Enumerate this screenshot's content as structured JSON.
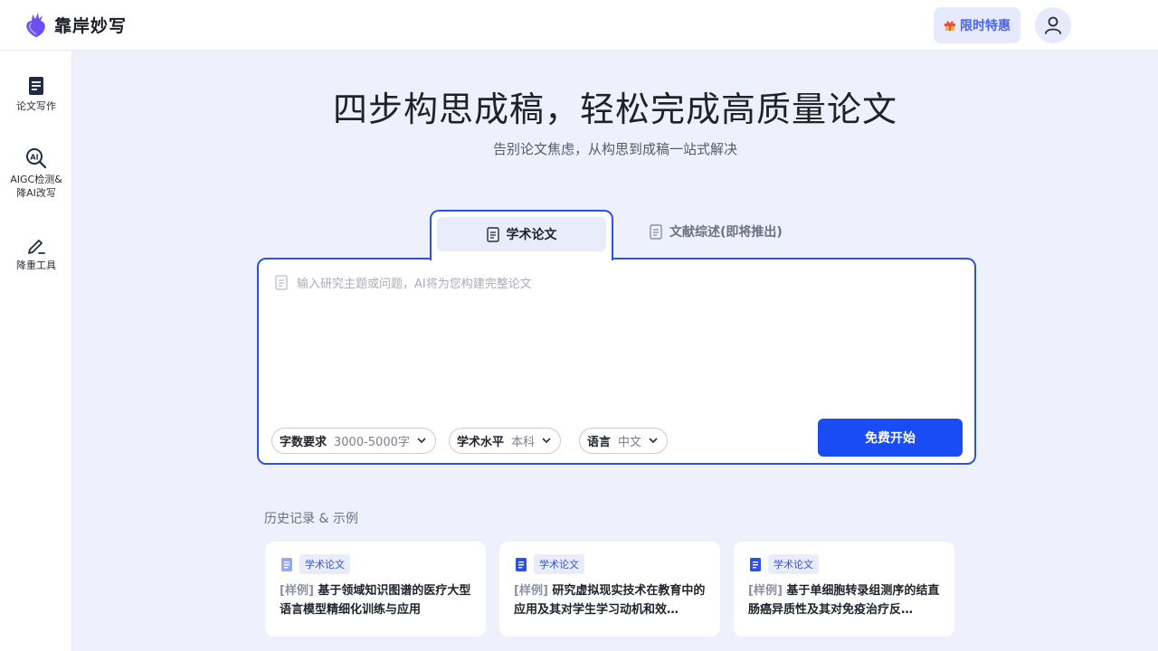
{
  "header": {
    "brand": "靠岸妙写",
    "promo_label": "限时特惠",
    "promo_icon": "gift-icon",
    "avatar_icon": "user-icon"
  },
  "sidebar": {
    "items": [
      {
        "label": "论文写作",
        "icon": "document-icon"
      },
      {
        "label": "AIGC检测&",
        "label2": "降AI改写",
        "icon": "ai-search-icon"
      },
      {
        "label": "降重工具",
        "icon": "pen-icon"
      }
    ]
  },
  "hero": {
    "title": "四步构思成稿，轻松完成高质量论文",
    "subtitle": "告别论文焦虑，从构思到成稿一站式解决"
  },
  "tabs": [
    {
      "label": "学术论文",
      "active": true
    },
    {
      "label": "文献综述(即将推出)",
      "active": false
    }
  ],
  "editor": {
    "placeholder": "输入研究主题或问题，AI将为您构建完整论文"
  },
  "options": {
    "word_count": {
      "key": "字数要求",
      "value": "3000-5000字"
    },
    "level": {
      "key": "学术水平",
      "value": "本科"
    },
    "language": {
      "key": "语言",
      "value": "中文"
    }
  },
  "start_button": "免费开始",
  "history": {
    "title": "历史记录 & 示例",
    "cards": [
      {
        "tag": "学术论文",
        "prefix": "[样例]",
        "text": "基于领域知识图谱的医疗大型语言模型精细化训练与应用"
      },
      {
        "tag": "学术论文",
        "prefix": "[样例]",
        "text": "研究虚拟现实技术在教育中的应用及其对学生学习动机和效…"
      },
      {
        "tag": "学术论文",
        "prefix": "[样例]",
        "text": "基于单细胞转录组测序的结直肠癌异质性及其对免疫治疗反…"
      }
    ]
  },
  "colors": {
    "accent": "#1a4cf5",
    "border_accent": "#2a52e6",
    "background": "#eef1fb"
  }
}
